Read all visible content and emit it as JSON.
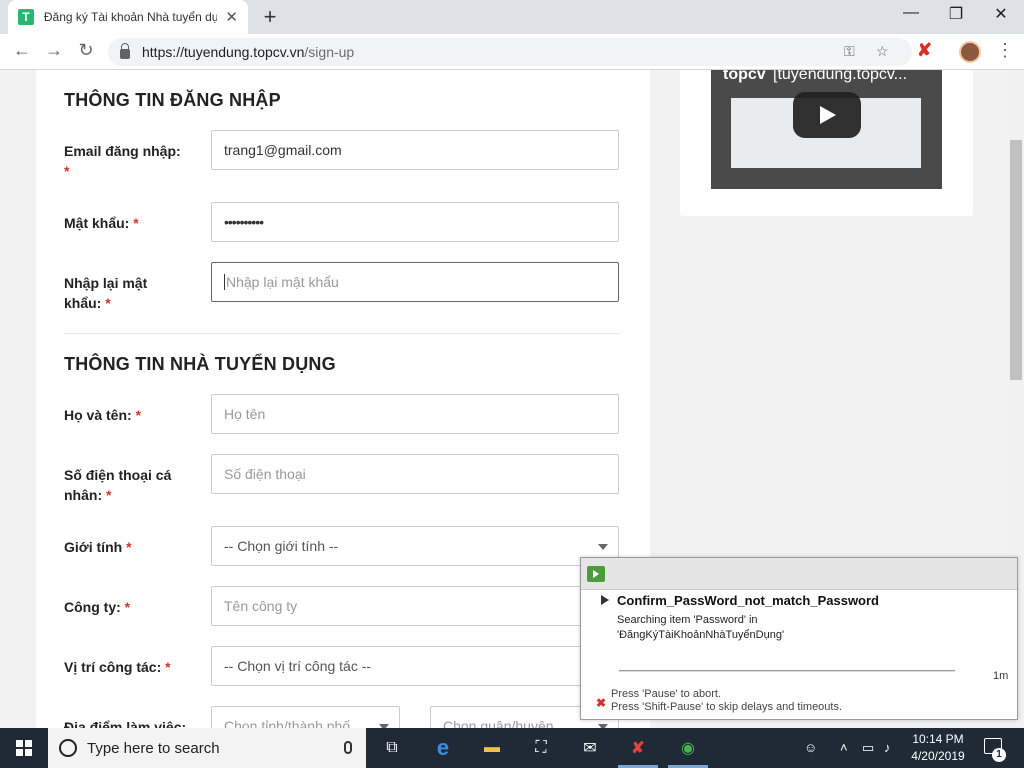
{
  "browser": {
    "tab_title": "Đăng ký Tài khoản Nhà tuyển dụng",
    "tab_favicon": "T",
    "url_host": "https://tuyendung.topcv.vn",
    "url_path": "/sign-up",
    "new_tab": "+",
    "window_controls": {
      "minimize": "—",
      "maximize": "❐",
      "close": "✕"
    }
  },
  "form": {
    "login_section_title": "THÔNG TIN ĐĂNG NHẬP",
    "email": {
      "label": "Email đăng nhập:",
      "value": "trang1@gmail.com"
    },
    "password": {
      "label": "Mật khẩu:",
      "value": "••••••••••"
    },
    "confirm_password": {
      "label": "Nhập lại mật khẩu:",
      "placeholder": "Nhập lại mật khẩu"
    },
    "employer_section_title": "THÔNG TIN NHÀ TUYỂN DỤNG",
    "full_name": {
      "label": "Họ và tên:",
      "placeholder": "Họ tên"
    },
    "phone": {
      "label": "Số điện thoại cá nhân:",
      "placeholder": "Số điện thoại"
    },
    "gender": {
      "label": "Giới tính",
      "selected": "-- Chọn giới tính --"
    },
    "company": {
      "label": "Công ty:",
      "placeholder": "Tên công ty"
    },
    "position": {
      "label": "Vị trí công tác:",
      "selected": "-- Chọn vị trí công tác --"
    },
    "location": {
      "label": "Địa điểm làm việc:",
      "province_placeholder": "Chọn tỉnh/thành phố",
      "district_placeholder": "Chọn quận/huyện"
    },
    "required_mark": "*"
  },
  "video": {
    "brand": "topcv",
    "title": "[tuyendung.topcv..."
  },
  "ranorex": {
    "test_name": "Confirm_PassWord_not_match_Password",
    "status_line1": "Searching item 'Password' in",
    "status_line2": "'ĐăngKýTàiKhoảnNhàTuyểnDụng'",
    "elapsed": "1m",
    "hint_pause": "Press 'Pause' to abort.",
    "hint_shift_pause": "Press 'Shift-Pause' to skip delays and timeouts.",
    "abort_icon": "✖"
  },
  "taskbar": {
    "search_text": "Type here to search",
    "time": "10:14 PM",
    "date": "4/20/2019",
    "notification_count": "1"
  },
  "colors": {
    "accent_green": "#2bb673",
    "required_red": "#d0342c",
    "taskbar": "#1f2a36"
  }
}
